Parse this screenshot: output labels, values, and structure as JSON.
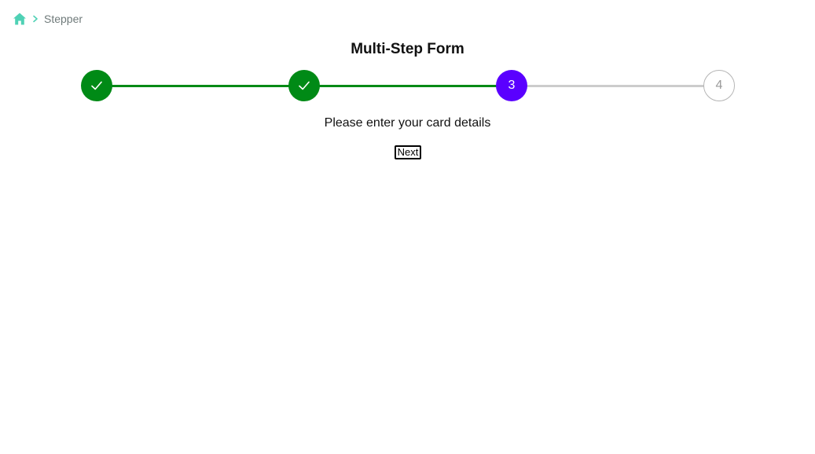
{
  "breadcrumb": {
    "home_icon": "home-icon",
    "separator_icon": "chevron-right-icon",
    "current": "Stepper"
  },
  "form": {
    "title": "Multi-Step Form",
    "message": "Please enter your card details",
    "next_label": "Next"
  },
  "stepper": {
    "current_step": 3,
    "total_steps": 4,
    "steps": [
      {
        "label": "1",
        "status": "completed",
        "icon": "check-icon"
      },
      {
        "label": "2",
        "status": "completed",
        "icon": "check-icon"
      },
      {
        "label": "3",
        "status": "active"
      },
      {
        "label": "4",
        "status": "pending"
      }
    ]
  },
  "colors": {
    "completed": "#008a16",
    "active": "#5a00ff",
    "pending_border": "#b5b5b5",
    "pending_text": "#9a9a9a",
    "incomplete_line": "#cccccc",
    "breadcrumb_accent": "#4fd1b5"
  }
}
